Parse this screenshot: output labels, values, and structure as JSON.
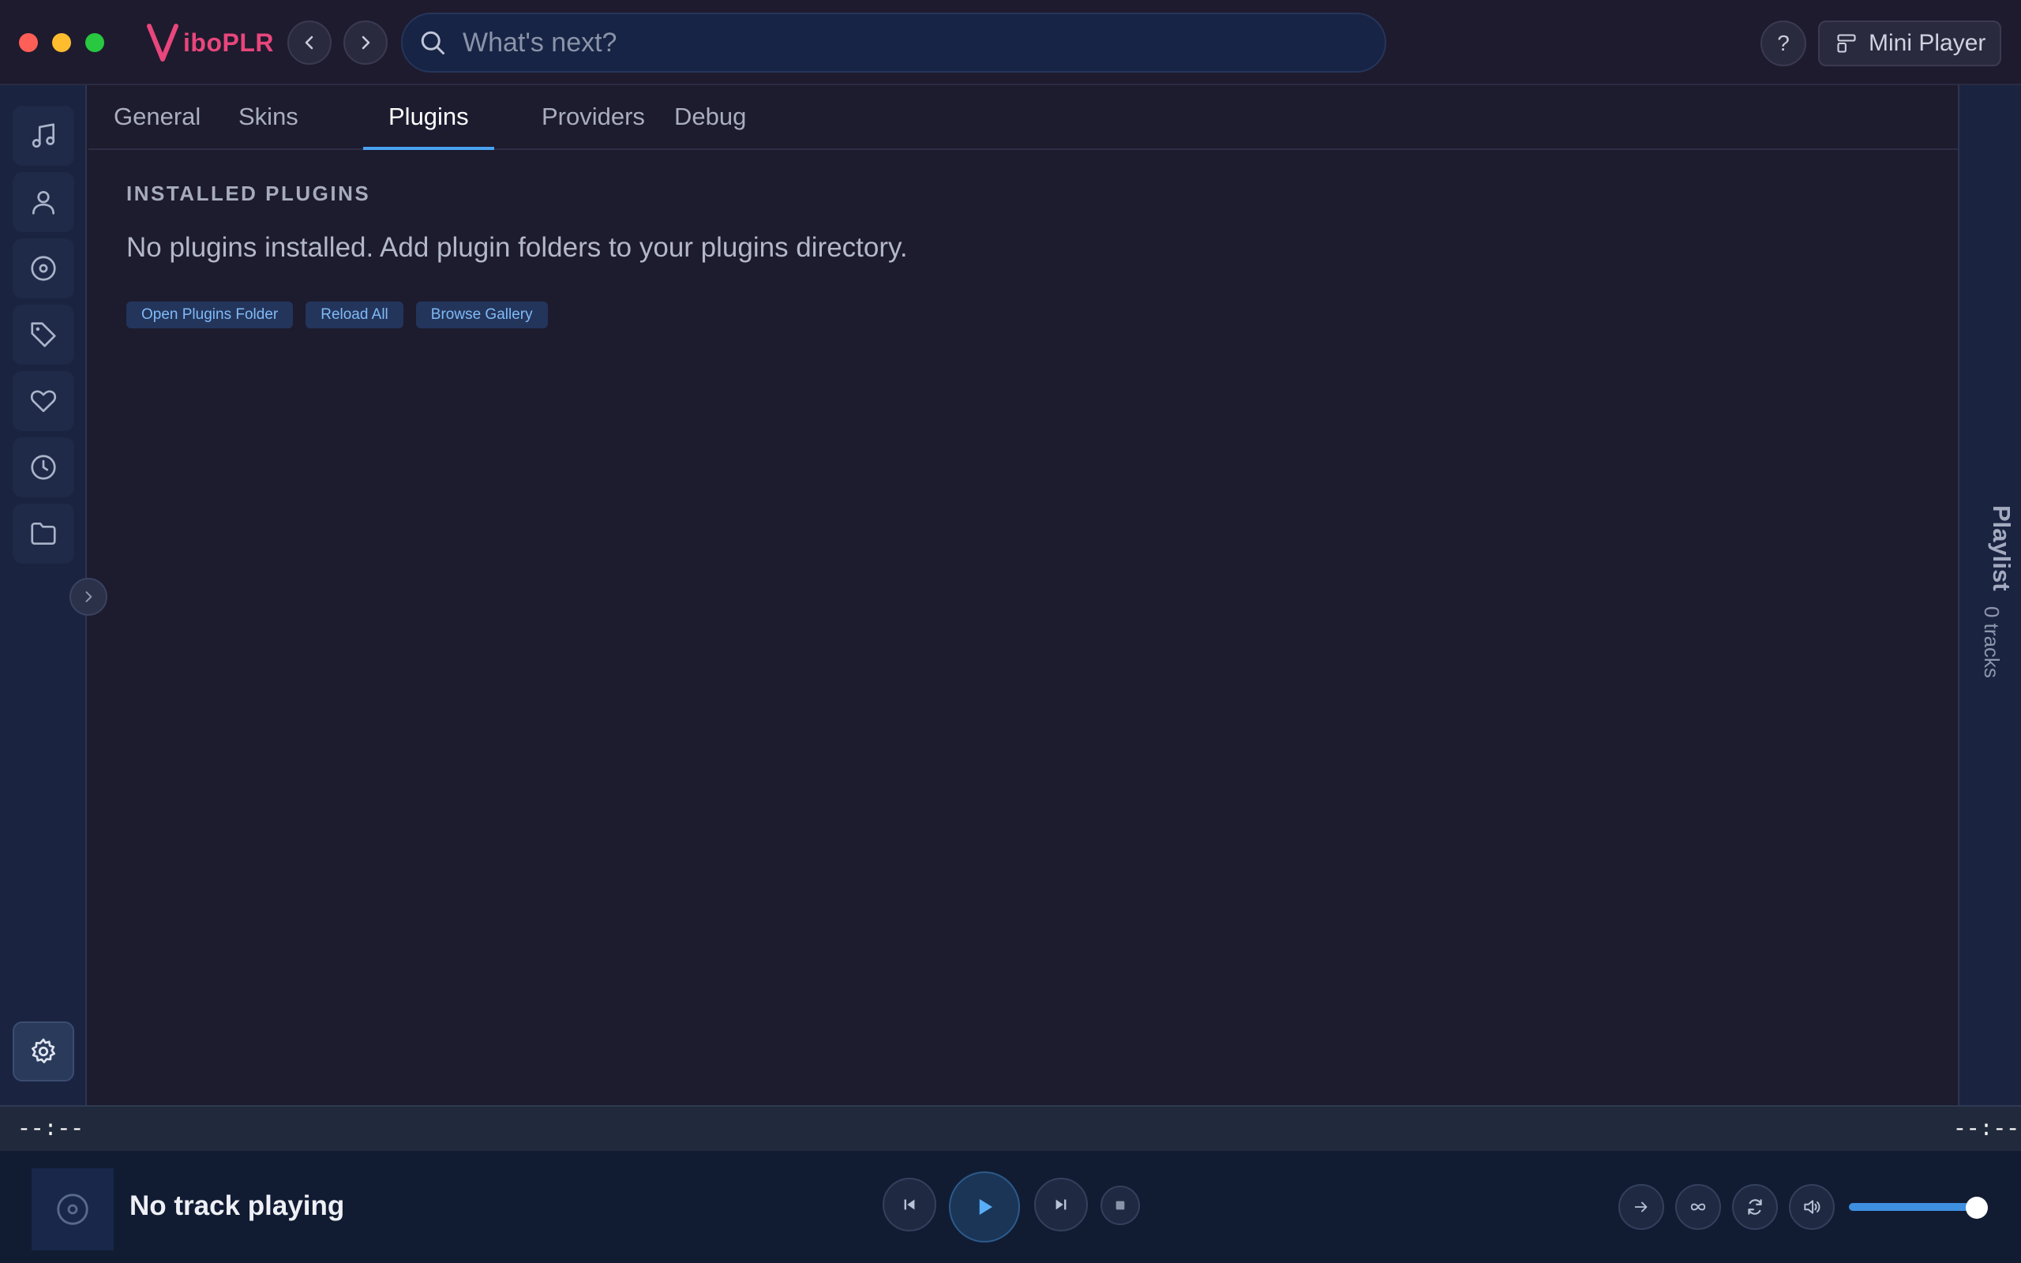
{
  "app": {
    "logo_text": "iboPLR",
    "brand_color": "#e8467c",
    "accent_color": "#4aa3f0"
  },
  "window_controls": {
    "close_color": "#ff5f57",
    "minimize_color": "#febc2e",
    "maximize_color": "#28c840"
  },
  "search": {
    "placeholder": "What's next?"
  },
  "header": {
    "help_label": "?",
    "mini_player_label": "Mini Player"
  },
  "sidebar": {
    "items": [
      {
        "icon": "music-note-icon"
      },
      {
        "icon": "user-icon"
      },
      {
        "icon": "disc-icon"
      },
      {
        "icon": "tag-icon"
      },
      {
        "icon": "heart-icon"
      },
      {
        "icon": "clock-icon"
      },
      {
        "icon": "folder-icon"
      }
    ],
    "settings_icon": "gear-icon"
  },
  "tabs": [
    {
      "label": "General"
    },
    {
      "label": "Skins"
    },
    {
      "label": "Plugins",
      "active": true
    },
    {
      "label": "Providers"
    },
    {
      "label": "Debug"
    }
  ],
  "plugins": {
    "section_title": "INSTALLED PLUGINS",
    "empty_message": "No plugins installed. Add plugin folders to your plugins directory.",
    "buttons": [
      "Open Plugins Folder",
      "Reload All",
      "Browse Gallery"
    ]
  },
  "playlist": {
    "label": "Playlist",
    "count": "0 tracks"
  },
  "timeline": {
    "elapsed": "--:--",
    "remaining": "--:--"
  },
  "player": {
    "track_title": "No track playing",
    "volume_percent": 100
  }
}
